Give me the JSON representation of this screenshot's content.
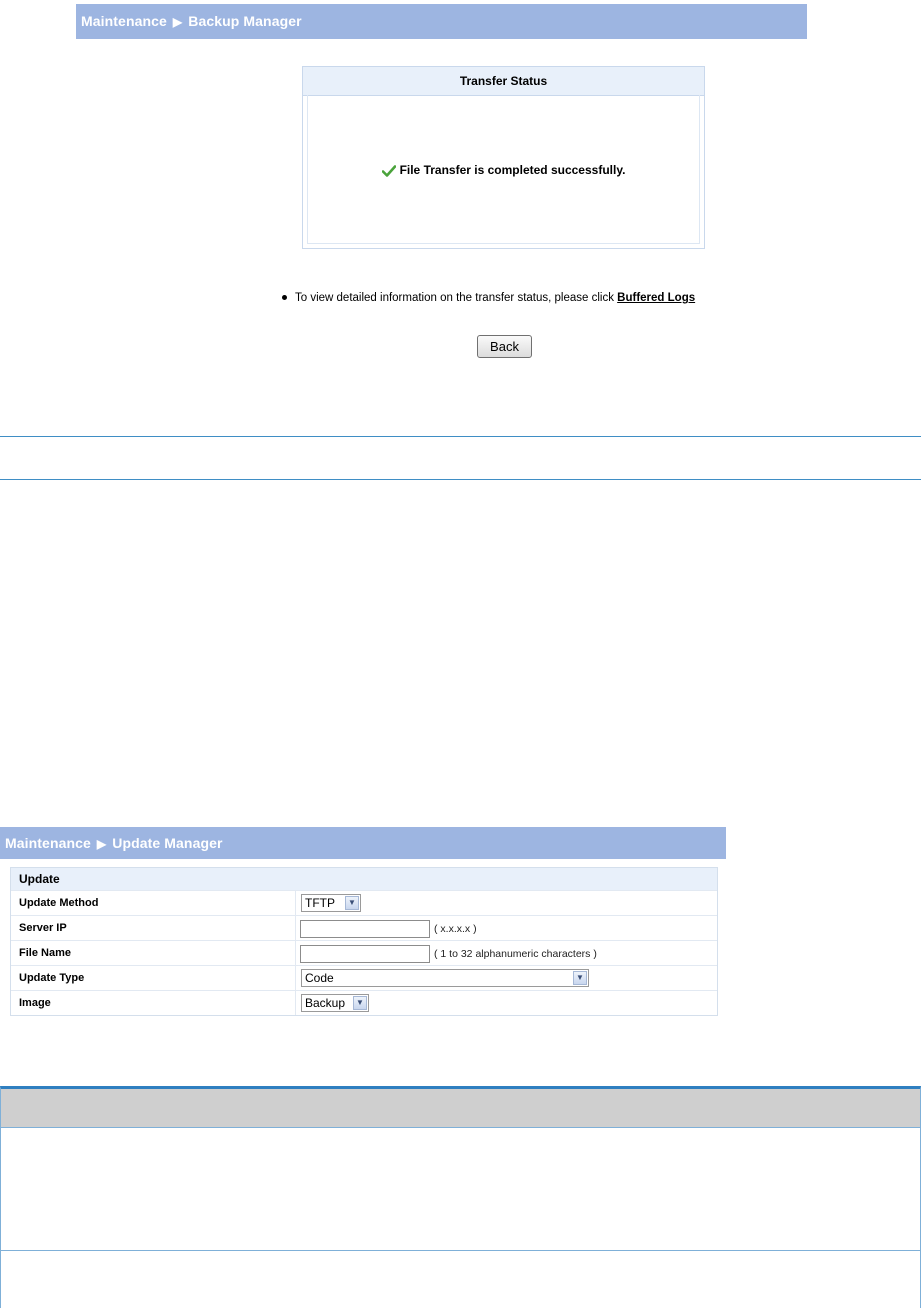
{
  "backup_header": {
    "section": "Maintenance",
    "page": "Backup Manager"
  },
  "transfer_status": {
    "title": "Transfer Status",
    "message": "File Transfer is completed successfully."
  },
  "info": {
    "text": "To view detailed information on the transfer status, please click ",
    "link": "Buffered Logs"
  },
  "back_button": "Back",
  "update_header": {
    "section": "Maintenance",
    "page": "Update Manager"
  },
  "update_table": {
    "title": "Update",
    "rows": {
      "method": {
        "label": "Update Method",
        "value": "TFTP"
      },
      "server_ip": {
        "label": "Server IP",
        "value": "",
        "hint": "( x.x.x.x )"
      },
      "file_name": {
        "label": "File Name",
        "value": "",
        "hint": "( 1 to 32 alphanumeric characters )"
      },
      "type": {
        "label": "Update Type",
        "value": "Code"
      },
      "image": {
        "label": "Image",
        "value": "Backup"
      }
    }
  },
  "colors": {
    "header_bar": "#9db5e1",
    "table_header": "#e8f0fa",
    "rule": "#3f8ec5",
    "ref_header": "#cfcfcf",
    "check": "#4aa33b"
  },
  "icons": {
    "check": "check-icon",
    "arrow": "arrow-right-icon",
    "dropdown": "chevron-down-icon"
  }
}
